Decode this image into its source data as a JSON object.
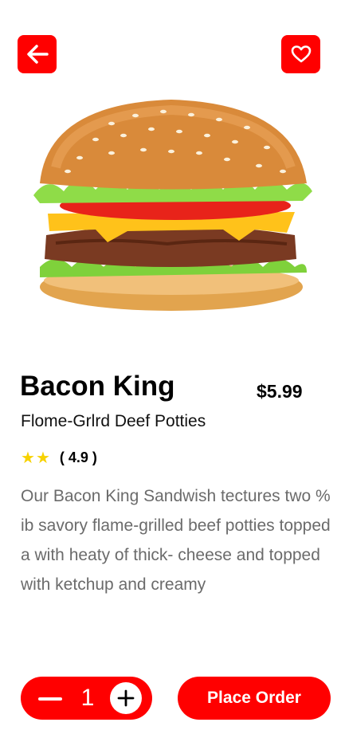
{
  "colors": {
    "accent": "#ff0000",
    "star": "#f7d200",
    "description": "#6b6b6b"
  },
  "header": {
    "back_icon": "arrow-left-icon",
    "favorite_icon": "heart-icon"
  },
  "product": {
    "image": "burger-image",
    "name": "Bacon King",
    "price": "$5.99",
    "subtitle": "Flome-Grlrd Deef Potties",
    "stars": 2,
    "rating": "( 4.9 )",
    "description": "Our Bacon King Sandwish tectures two % ib savory flame-grilled beef potties topped a with heaty of thick- cheese and topped with ketchup and creamy"
  },
  "order": {
    "quantity": "1",
    "minus_icon": "minus-icon",
    "plus_icon": "plus-icon",
    "place_order_label": "Place Order"
  }
}
